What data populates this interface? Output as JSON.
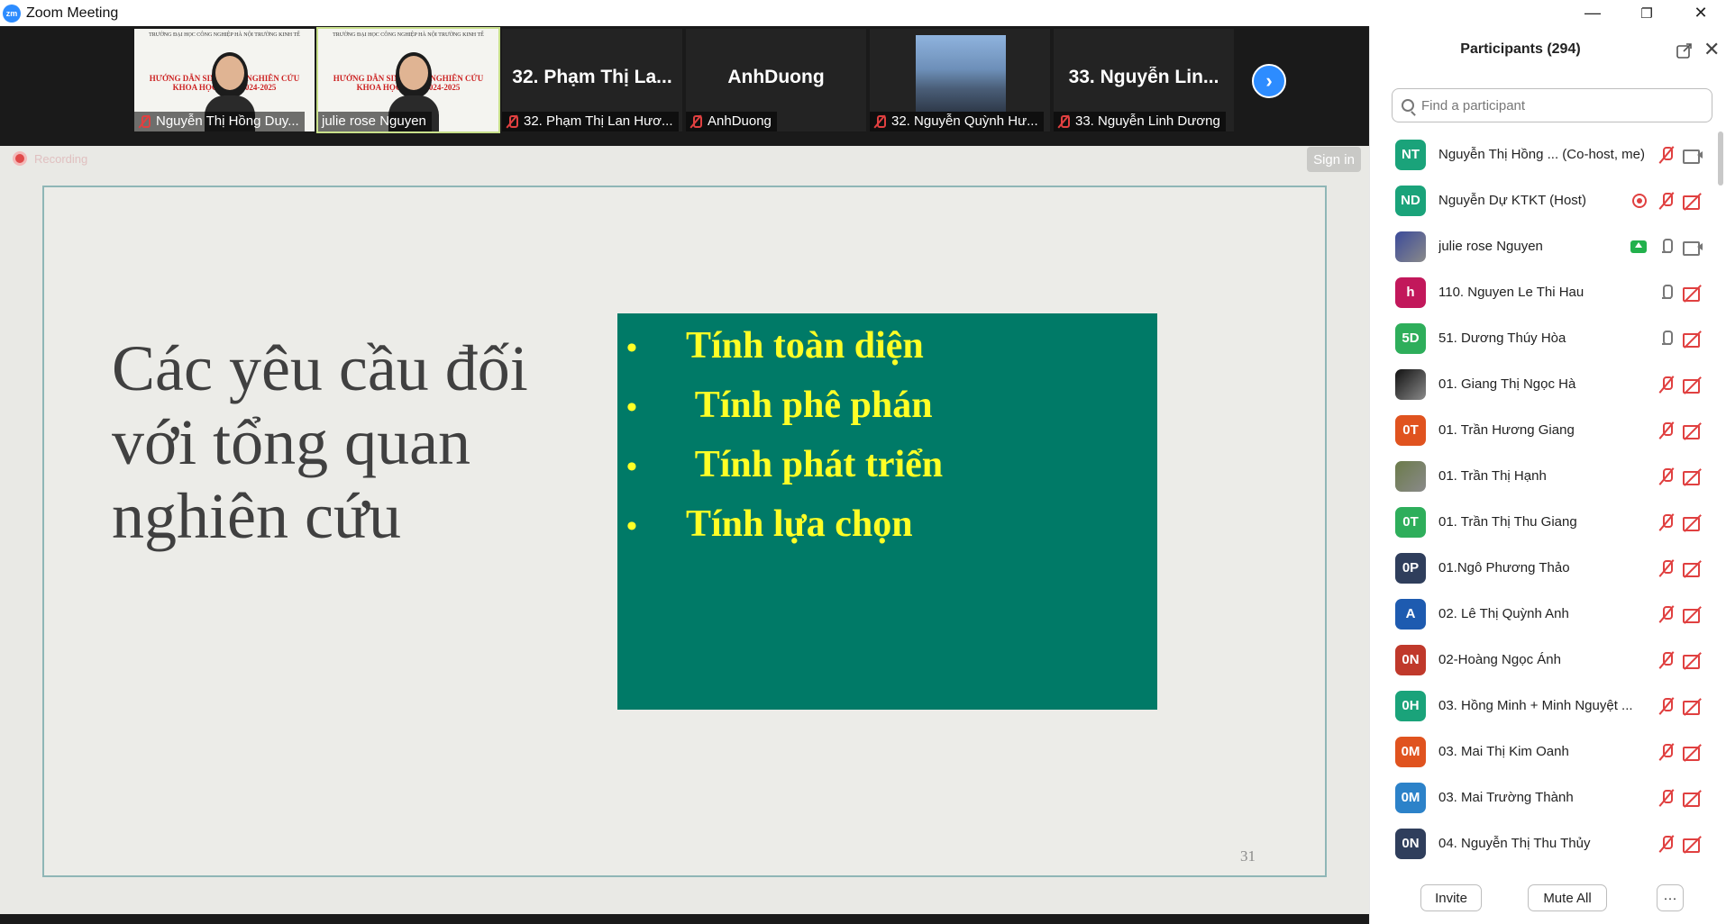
{
  "window": {
    "title": "Zoom Meeting",
    "logo_text": "zm",
    "minimize": "—",
    "restore": "❐",
    "close": "✕"
  },
  "filmstrip": {
    "tiles": [
      {
        "label": "Nguyễn Thị Hồng Duy...",
        "muted": true,
        "thumb_line1": "TRƯỜNG ĐẠI HỌC CÔNG NGHIỆP HÀ NỘI TRƯỜNG KINH TẾ",
        "thumb_line2": "HƯỚNG DẪN SINH VIÊN NGHIÊN CỨU KHOA HỌC NĂM 2024-2025"
      },
      {
        "label": "julie rose Nguyen",
        "muted": false,
        "active": true,
        "thumb_line1": "TRƯỜNG ĐẠI HỌC CÔNG NGHIỆP HÀ NỘI TRƯỜNG KINH TẾ",
        "thumb_line2": "HƯỚNG DẪN SINH VIÊN NGHIÊN CỨU KHOA HỌC NĂM 2024-2025"
      },
      {
        "big_name": "32. Phạm Thị La...",
        "label": "32. Phạm Thị Lan Hươ...",
        "muted": true
      },
      {
        "big_name": "AnhDuong",
        "label": "AnhDuong",
        "muted": true
      },
      {
        "label": "32. Nguyễn Quỳnh Hư...",
        "muted": true
      },
      {
        "big_name": "33. Nguyễn Lin...",
        "label": "33. Nguyễn Linh Dương",
        "muted": true
      }
    ],
    "next_icon": "›"
  },
  "share": {
    "recording_label": "Recording",
    "signin_label": "Sign in",
    "slide": {
      "title": "Các yêu cầu đối với tổng quan nghiên cứu",
      "bullets": [
        "Tính toàn diện",
        " Tính phê phán",
        " Tính phát triển",
        "Tính lựa chọn"
      ],
      "bullet_symbol": "•",
      "page_number": "31",
      "box_color": "#007a67",
      "bullet_color": "#ffff26"
    }
  },
  "participants": {
    "title": "Participants (294)",
    "search_placeholder": "Find a participant",
    "list": [
      {
        "initials": "NT",
        "color": "#1aa37a",
        "name": "Nguyễn Thị Hồng ... (Co-host, me)",
        "mic": "muted",
        "cam": "on"
      },
      {
        "initials": "ND",
        "color": "#1aa37a",
        "name": "Nguyễn Dự KTKT (Host)",
        "mic": "muted",
        "cam": "off",
        "recording": true
      },
      {
        "initials": "",
        "color": "#3b4a9a",
        "name": "julie rose Nguyen",
        "mic": "on",
        "cam": "on",
        "sharing": true,
        "photo": true
      },
      {
        "initials": "h",
        "color": "#c2185b",
        "name": "110. Nguyen Le Thi Hau",
        "mic": "on",
        "cam": "off"
      },
      {
        "initials": "5D",
        "color": "#2eae5b",
        "name": "51. Dương Thúy Hòa",
        "mic": "on",
        "cam": "off"
      },
      {
        "initials": "",
        "color": "#111111",
        "name": "01. Giang Thị Ngọc Hà",
        "mic": "muted",
        "cam": "off",
        "photo": true
      },
      {
        "initials": "0T",
        "color": "#e0531f",
        "name": "01. Trần Hương Giang",
        "mic": "muted",
        "cam": "off"
      },
      {
        "initials": "",
        "color": "#6b7b4a",
        "name": "01. Trần Thị Hạnh",
        "mic": "muted",
        "cam": "off",
        "photo": true
      },
      {
        "initials": "0T",
        "color": "#2eae5b",
        "name": "01. Trần Thị Thu Giang",
        "mic": "muted",
        "cam": "off"
      },
      {
        "initials": "0P",
        "color": "#2f3e5c",
        "name": "01.Ngô Phương Thảo",
        "mic": "muted",
        "cam": "off"
      },
      {
        "initials": "A",
        "color": "#1e5bb0",
        "name": "02. Lê Thị Quỳnh Anh",
        "mic": "muted",
        "cam": "off"
      },
      {
        "initials": "0N",
        "color": "#c0392b",
        "name": "02-Hoàng Ngọc Ánh",
        "mic": "muted",
        "cam": "off"
      },
      {
        "initials": "0H",
        "color": "#1aa37a",
        "name": "03. Hồng Minh + Minh Nguyệt ...",
        "mic": "muted",
        "cam": "off"
      },
      {
        "initials": "0M",
        "color": "#e0531f",
        "name": "03. Mai Thị Kim Oanh",
        "mic": "muted",
        "cam": "off"
      },
      {
        "initials": "0M",
        "color": "#2c82c9",
        "name": "03. Mai Trường Thành",
        "mic": "muted",
        "cam": "off"
      },
      {
        "initials": "0N",
        "color": "#2f3e5c",
        "name": "04. Nguyễn Thị Thu Thủy",
        "mic": "muted",
        "cam": "off"
      }
    ],
    "invite_label": "Invite",
    "mute_all_label": "Mute All",
    "more_label": "···",
    "close_icon": "✕"
  }
}
